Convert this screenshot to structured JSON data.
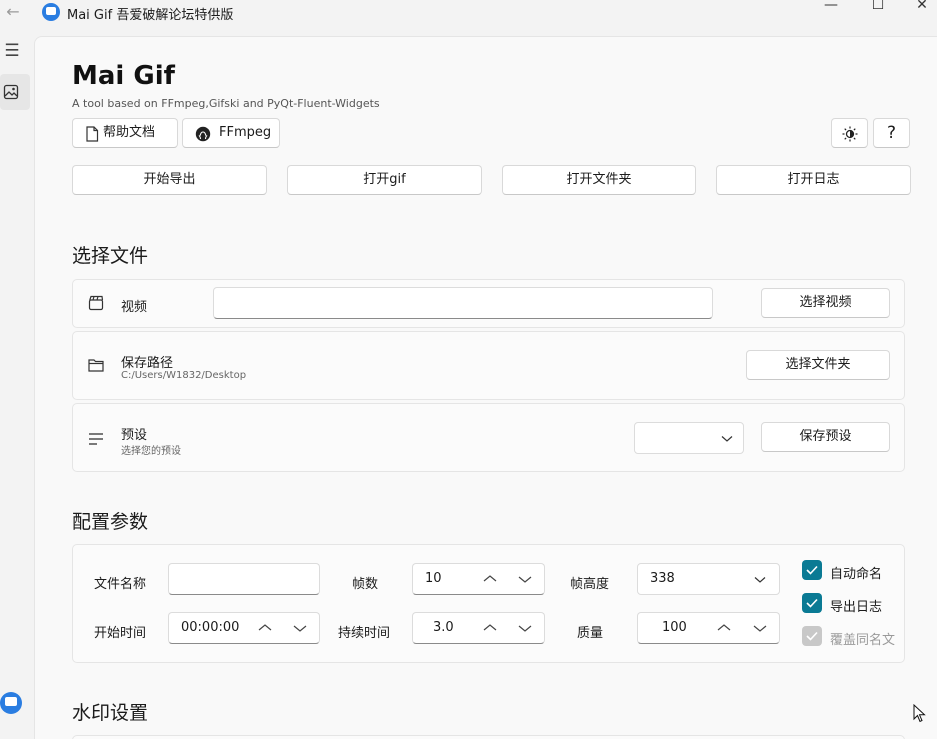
{
  "window": {
    "title": "Mai Gif  吾爱破解论坛特供版",
    "minimize": "—",
    "maximize": "☐",
    "close": "✕"
  },
  "nav": {
    "menu_icon": "hamburger-icon",
    "items": [
      {
        "icon": "image-icon",
        "selected": true
      }
    ],
    "avatar_icon": "app-avatar-icon"
  },
  "header": {
    "title": "Mai Gif",
    "subtitle": "A tool based on FFmpeg,Gifski and PyQt-Fluent-Widgets",
    "help_doc_label": "帮助文档",
    "ffmpeg_label": "FFmpeg",
    "theme_icon": "brightness-icon",
    "help_label": "?"
  },
  "actions": {
    "start_export": "开始导出",
    "open_gif": "打开gif",
    "open_folder": "打开文件夹",
    "open_log": "打开日志"
  },
  "select_file": {
    "title": "选择文件",
    "video": {
      "label": "视频",
      "input_value": "",
      "button": "选择视频"
    },
    "save_path": {
      "label": "保存路径",
      "value": "C:/Users/W1832/Desktop",
      "button": "选择文件夹"
    },
    "preset": {
      "label": "预设",
      "description": "选择您的预设",
      "selected": "",
      "button": "保存预设"
    }
  },
  "config": {
    "title": "配置参数",
    "file_name": {
      "label": "文件名称",
      "value": ""
    },
    "fps": {
      "label": "帧数",
      "value": "10"
    },
    "frame_height": {
      "label": "帧高度",
      "value": "338"
    },
    "start_time": {
      "label": "开始时间",
      "value": "00:00:00"
    },
    "duration": {
      "label": "持续时间",
      "value": "3.0"
    },
    "quality": {
      "label": "质量",
      "value": "100"
    },
    "auto_name": {
      "label": "自动命名",
      "checked": true
    },
    "export_log": {
      "label": "导出日志",
      "checked": true
    },
    "overwrite": {
      "label": "覆盖同名文",
      "checked": true,
      "disabled": true
    }
  },
  "watermark": {
    "title": "水印设置"
  },
  "colors": {
    "accent": "#0a7a94",
    "app_blue": "#2a7de1"
  }
}
